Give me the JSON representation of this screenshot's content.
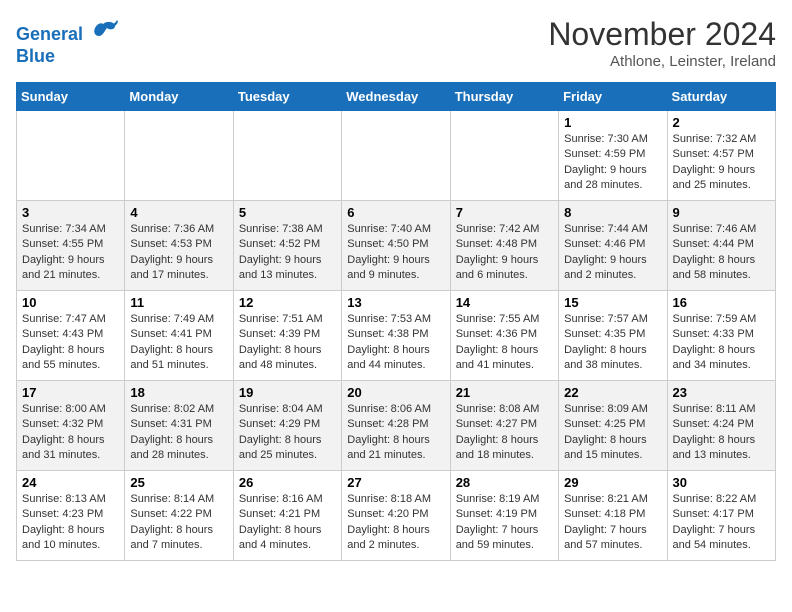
{
  "header": {
    "logo_line1": "General",
    "logo_line2": "Blue",
    "month_title": "November 2024",
    "subtitle": "Athlone, Leinster, Ireland"
  },
  "days_of_week": [
    "Sunday",
    "Monday",
    "Tuesday",
    "Wednesday",
    "Thursday",
    "Friday",
    "Saturday"
  ],
  "weeks": [
    [
      {
        "day": "",
        "sunrise": "",
        "sunset": "",
        "daylight": ""
      },
      {
        "day": "",
        "sunrise": "",
        "sunset": "",
        "daylight": ""
      },
      {
        "day": "",
        "sunrise": "",
        "sunset": "",
        "daylight": ""
      },
      {
        "day": "",
        "sunrise": "",
        "sunset": "",
        "daylight": ""
      },
      {
        "day": "",
        "sunrise": "",
        "sunset": "",
        "daylight": ""
      },
      {
        "day": "1",
        "sunrise": "Sunrise: 7:30 AM",
        "sunset": "Sunset: 4:59 PM",
        "daylight": "Daylight: 9 hours and 28 minutes."
      },
      {
        "day": "2",
        "sunrise": "Sunrise: 7:32 AM",
        "sunset": "Sunset: 4:57 PM",
        "daylight": "Daylight: 9 hours and 25 minutes."
      }
    ],
    [
      {
        "day": "3",
        "sunrise": "Sunrise: 7:34 AM",
        "sunset": "Sunset: 4:55 PM",
        "daylight": "Daylight: 9 hours and 21 minutes."
      },
      {
        "day": "4",
        "sunrise": "Sunrise: 7:36 AM",
        "sunset": "Sunset: 4:53 PM",
        "daylight": "Daylight: 9 hours and 17 minutes."
      },
      {
        "day": "5",
        "sunrise": "Sunrise: 7:38 AM",
        "sunset": "Sunset: 4:52 PM",
        "daylight": "Daylight: 9 hours and 13 minutes."
      },
      {
        "day": "6",
        "sunrise": "Sunrise: 7:40 AM",
        "sunset": "Sunset: 4:50 PM",
        "daylight": "Daylight: 9 hours and 9 minutes."
      },
      {
        "day": "7",
        "sunrise": "Sunrise: 7:42 AM",
        "sunset": "Sunset: 4:48 PM",
        "daylight": "Daylight: 9 hours and 6 minutes."
      },
      {
        "day": "8",
        "sunrise": "Sunrise: 7:44 AM",
        "sunset": "Sunset: 4:46 PM",
        "daylight": "Daylight: 9 hours and 2 minutes."
      },
      {
        "day": "9",
        "sunrise": "Sunrise: 7:46 AM",
        "sunset": "Sunset: 4:44 PM",
        "daylight": "Daylight: 8 hours and 58 minutes."
      }
    ],
    [
      {
        "day": "10",
        "sunrise": "Sunrise: 7:47 AM",
        "sunset": "Sunset: 4:43 PM",
        "daylight": "Daylight: 8 hours and 55 minutes."
      },
      {
        "day": "11",
        "sunrise": "Sunrise: 7:49 AM",
        "sunset": "Sunset: 4:41 PM",
        "daylight": "Daylight: 8 hours and 51 minutes."
      },
      {
        "day": "12",
        "sunrise": "Sunrise: 7:51 AM",
        "sunset": "Sunset: 4:39 PM",
        "daylight": "Daylight: 8 hours and 48 minutes."
      },
      {
        "day": "13",
        "sunrise": "Sunrise: 7:53 AM",
        "sunset": "Sunset: 4:38 PM",
        "daylight": "Daylight: 8 hours and 44 minutes."
      },
      {
        "day": "14",
        "sunrise": "Sunrise: 7:55 AM",
        "sunset": "Sunset: 4:36 PM",
        "daylight": "Daylight: 8 hours and 41 minutes."
      },
      {
        "day": "15",
        "sunrise": "Sunrise: 7:57 AM",
        "sunset": "Sunset: 4:35 PM",
        "daylight": "Daylight: 8 hours and 38 minutes."
      },
      {
        "day": "16",
        "sunrise": "Sunrise: 7:59 AM",
        "sunset": "Sunset: 4:33 PM",
        "daylight": "Daylight: 8 hours and 34 minutes."
      }
    ],
    [
      {
        "day": "17",
        "sunrise": "Sunrise: 8:00 AM",
        "sunset": "Sunset: 4:32 PM",
        "daylight": "Daylight: 8 hours and 31 minutes."
      },
      {
        "day": "18",
        "sunrise": "Sunrise: 8:02 AM",
        "sunset": "Sunset: 4:31 PM",
        "daylight": "Daylight: 8 hours and 28 minutes."
      },
      {
        "day": "19",
        "sunrise": "Sunrise: 8:04 AM",
        "sunset": "Sunset: 4:29 PM",
        "daylight": "Daylight: 8 hours and 25 minutes."
      },
      {
        "day": "20",
        "sunrise": "Sunrise: 8:06 AM",
        "sunset": "Sunset: 4:28 PM",
        "daylight": "Daylight: 8 hours and 21 minutes."
      },
      {
        "day": "21",
        "sunrise": "Sunrise: 8:08 AM",
        "sunset": "Sunset: 4:27 PM",
        "daylight": "Daylight: 8 hours and 18 minutes."
      },
      {
        "day": "22",
        "sunrise": "Sunrise: 8:09 AM",
        "sunset": "Sunset: 4:25 PM",
        "daylight": "Daylight: 8 hours and 15 minutes."
      },
      {
        "day": "23",
        "sunrise": "Sunrise: 8:11 AM",
        "sunset": "Sunset: 4:24 PM",
        "daylight": "Daylight: 8 hours and 13 minutes."
      }
    ],
    [
      {
        "day": "24",
        "sunrise": "Sunrise: 8:13 AM",
        "sunset": "Sunset: 4:23 PM",
        "daylight": "Daylight: 8 hours and 10 minutes."
      },
      {
        "day": "25",
        "sunrise": "Sunrise: 8:14 AM",
        "sunset": "Sunset: 4:22 PM",
        "daylight": "Daylight: 8 hours and 7 minutes."
      },
      {
        "day": "26",
        "sunrise": "Sunrise: 8:16 AM",
        "sunset": "Sunset: 4:21 PM",
        "daylight": "Daylight: 8 hours and 4 minutes."
      },
      {
        "day": "27",
        "sunrise": "Sunrise: 8:18 AM",
        "sunset": "Sunset: 4:20 PM",
        "daylight": "Daylight: 8 hours and 2 minutes."
      },
      {
        "day": "28",
        "sunrise": "Sunrise: 8:19 AM",
        "sunset": "Sunset: 4:19 PM",
        "daylight": "Daylight: 7 hours and 59 minutes."
      },
      {
        "day": "29",
        "sunrise": "Sunrise: 8:21 AM",
        "sunset": "Sunset: 4:18 PM",
        "daylight": "Daylight: 7 hours and 57 minutes."
      },
      {
        "day": "30",
        "sunrise": "Sunrise: 8:22 AM",
        "sunset": "Sunset: 4:17 PM",
        "daylight": "Daylight: 7 hours and 54 minutes."
      }
    ]
  ]
}
